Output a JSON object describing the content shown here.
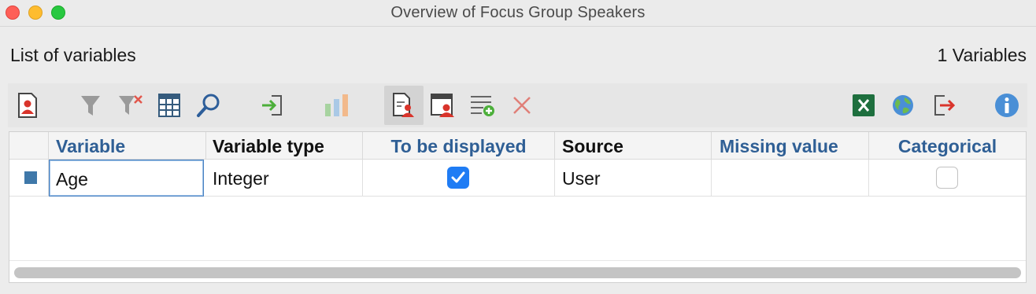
{
  "window": {
    "title": "Overview of Focus Group Speakers"
  },
  "header": {
    "left_label": "List of variables",
    "right_label": "1 Variables"
  },
  "toolbar": {
    "buttons": [
      {
        "name": "new-variable",
        "icon": "person-document-icon"
      },
      {
        "name": "filter",
        "icon": "filter-icon"
      },
      {
        "name": "clear-filter",
        "icon": "filter-clear-icon"
      },
      {
        "name": "columns",
        "icon": "columns-icon"
      },
      {
        "name": "search",
        "icon": "search-icon"
      },
      {
        "name": "import",
        "icon": "import-icon"
      },
      {
        "name": "chart",
        "icon": "bar-chart-icon"
      },
      {
        "name": "speaker-variables",
        "icon": "speaker-list-icon",
        "active": true
      },
      {
        "name": "speaker-overview",
        "icon": "speaker-table-icon"
      },
      {
        "name": "add-variable",
        "icon": "list-add-icon"
      },
      {
        "name": "delete",
        "icon": "delete-x-icon"
      },
      {
        "name": "excel-export",
        "icon": "excel-icon"
      },
      {
        "name": "web-export",
        "icon": "globe-icon"
      },
      {
        "name": "export",
        "icon": "export-icon"
      },
      {
        "name": "info",
        "icon": "info-icon"
      }
    ]
  },
  "table": {
    "columns": [
      "Variable",
      "Variable type",
      "To be displayed",
      "Source",
      "Missing value",
      "Categorical"
    ],
    "rows": [
      {
        "variable": "Age",
        "type": "Integer",
        "to_be_displayed": true,
        "source": "User",
        "missing_value": "",
        "categorical": false
      }
    ]
  },
  "colors": {
    "header_blue": "#2f5f95",
    "row_marker": "#3f78a9",
    "checkbox_checked": "#1f7cf4"
  }
}
